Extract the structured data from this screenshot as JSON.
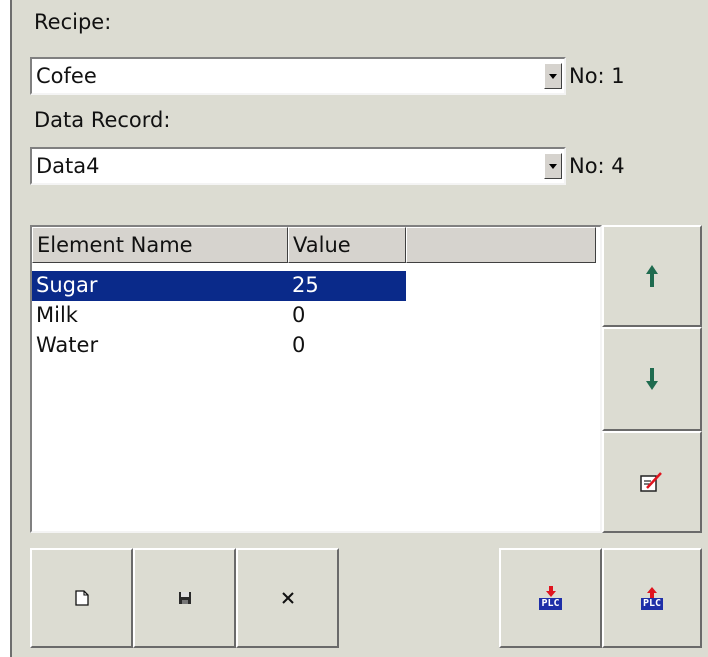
{
  "recipe": {
    "label": "Recipe:",
    "selected": "Cofee",
    "number": "No: 1"
  },
  "data_record": {
    "label": "Data Record:",
    "selected": "Data4",
    "number": "No: 4"
  },
  "table": {
    "columns": [
      "Element Name",
      "Value"
    ],
    "rows": [
      {
        "name": "Sugar",
        "value": "25",
        "selected": true
      },
      {
        "name": "Milk",
        "value": "0",
        "selected": false
      },
      {
        "name": "Water",
        "value": "0",
        "selected": false
      }
    ]
  },
  "buttons": {
    "plc_download_text": "PLC",
    "plc_upload_text": "PLC"
  },
  "icons": {
    "move_up": "arrow-up-icon",
    "move_down": "arrow-down-icon",
    "edit": "edit-icon",
    "new": "new-document-icon",
    "save": "save-icon",
    "delete": "close-icon",
    "download_plc": "download-to-plc-icon",
    "upload_plc": "upload-from-plc-icon"
  },
  "colors": {
    "panel_bg": "#dcdcd2",
    "selection_bg": "#0a2a8a",
    "arrow_icon": "#1f6b4f",
    "plc_blue": "#1e2fa8",
    "plc_red": "#e0141e"
  }
}
